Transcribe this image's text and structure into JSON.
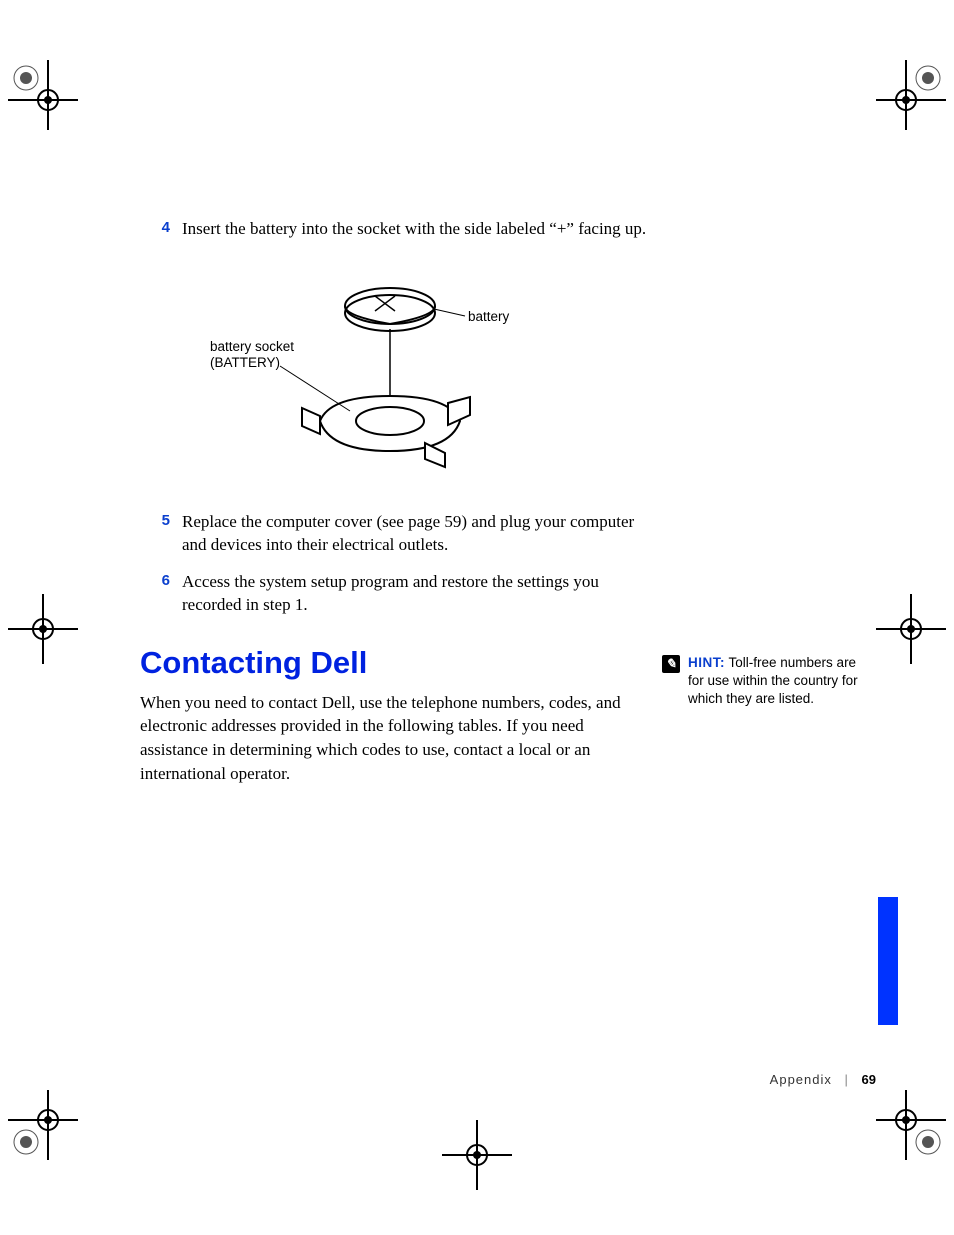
{
  "steps": {
    "s4": {
      "num": "4",
      "text": "Insert the battery into the socket with the side labeled “+” facing up."
    },
    "s5": {
      "num": "5",
      "text": "Replace the computer cover (see page 59) and plug your computer and devices into their electrical outlets."
    },
    "s6": {
      "num": "6",
      "text": "Access the system setup program and restore the settings you recorded in step 1."
    }
  },
  "figure": {
    "label_battery": "battery",
    "label_socket_line1": "battery socket",
    "label_socket_line2": "(BATTERY)"
  },
  "heading": "Contacting Dell",
  "intro": "When you need to contact Dell, use the telephone numbers, codes, and electronic addresses provided in the following tables. If you need assistance in determining which codes to use, contact a local or an international operator.",
  "hint": {
    "label": "HINT:",
    "text": "Toll-free numbers are for use within the country for which they are listed."
  },
  "footer": {
    "section": "Appendix",
    "page": "69"
  }
}
